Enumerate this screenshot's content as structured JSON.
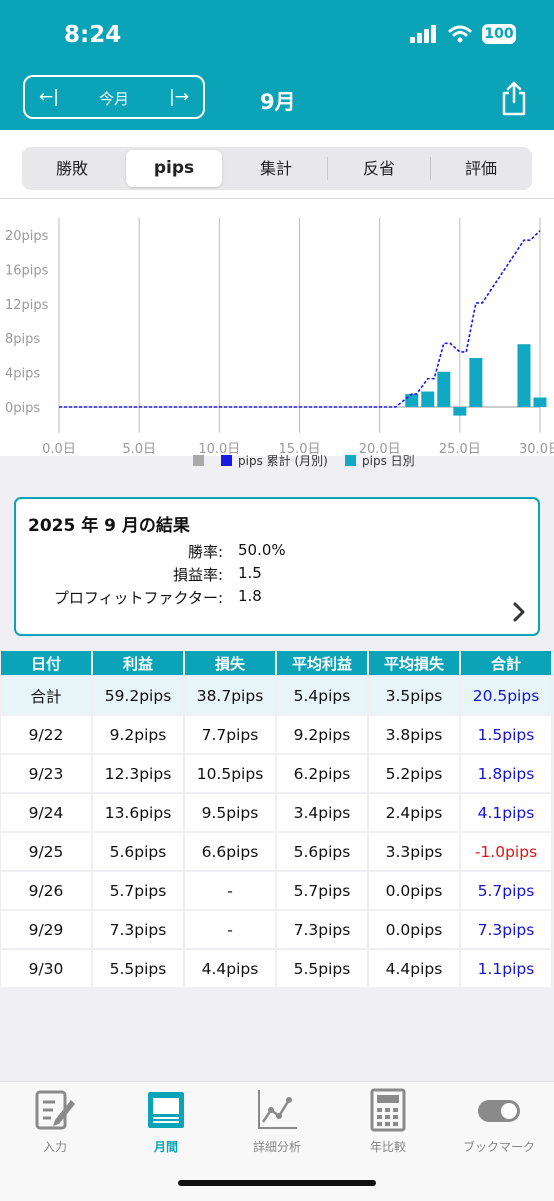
{
  "status_bar": {
    "time": "8:24",
    "battery": "100"
  },
  "header": {
    "prev_arrow": "←|",
    "today_label": "今月",
    "next_arrow": "|→",
    "month_title": "9月"
  },
  "segments": [
    "勝敗",
    "pips",
    "集計",
    "反省",
    "評価"
  ],
  "selected_segment": "pips",
  "chart_data": {
    "type": "bar+line",
    "x_tick_labels": [
      "0.0日",
      "5.0日",
      "10.0日",
      "15.0日",
      "20.0日",
      "25.0日",
      "30.0日"
    ],
    "y_tick_labels": [
      "0pips",
      "4pips",
      "8pips",
      "12pips",
      "16pips",
      "20pips"
    ],
    "xlim": [
      0,
      30
    ],
    "ylim": [
      -3,
      22
    ],
    "grid": true,
    "legend_placement": "bottom",
    "legend": [
      "",
      "pips 累計 (月別)",
      "pips 日別"
    ],
    "series": [
      {
        "name": "pips 累計 (月別)",
        "type": "line",
        "style": "dashed",
        "color": "#1a1ae6",
        "x": [
          0,
          21,
          22,
          22.3,
          23,
          23.4,
          24,
          24.4,
          25,
          25.4,
          26,
          26.4,
          29,
          29.4,
          30
        ],
        "y": [
          0,
          0,
          1.5,
          1.5,
          3.3,
          3.3,
          7.4,
          7.4,
          6.4,
          6.4,
          12.1,
          12.1,
          19.4,
          19.4,
          20.5
        ]
      },
      {
        "name": "pips 日別",
        "type": "bar",
        "color": "#10a8c2",
        "x": [
          22,
          23,
          24,
          25,
          26,
          29,
          30
        ],
        "values": [
          1.5,
          1.8,
          4.1,
          -1.0,
          5.7,
          7.3,
          1.1
        ]
      }
    ]
  },
  "result": {
    "title": "2025 年 9 月の結果",
    "win_rate_label": "勝率:",
    "win_rate": "50.0%",
    "pl_ratio_label": "損益率:",
    "pl_ratio": "1.5",
    "profit_factor_label": "プロフィットファクター:",
    "profit_factor": "1.8"
  },
  "table": {
    "headers": [
      "日付",
      "利益",
      "損失",
      "平均利益",
      "平均損失",
      "合計"
    ],
    "rows": [
      {
        "date": "合計",
        "profit": "59.2pips",
        "loss": "38.7pips",
        "avg_profit": "5.4pips",
        "avg_loss": "3.5pips",
        "total": "20.5pips",
        "sign": "pos"
      },
      {
        "date": "9/22",
        "profit": "9.2pips",
        "loss": "7.7pips",
        "avg_profit": "9.2pips",
        "avg_loss": "3.8pips",
        "total": "1.5pips",
        "sign": "pos"
      },
      {
        "date": "9/23",
        "profit": "12.3pips",
        "loss": "10.5pips",
        "avg_profit": "6.2pips",
        "avg_loss": "5.2pips",
        "total": "1.8pips",
        "sign": "pos"
      },
      {
        "date": "9/24",
        "profit": "13.6pips",
        "loss": "9.5pips",
        "avg_profit": "3.4pips",
        "avg_loss": "2.4pips",
        "total": "4.1pips",
        "sign": "pos"
      },
      {
        "date": "9/25",
        "profit": "5.6pips",
        "loss": "6.6pips",
        "avg_profit": "5.6pips",
        "avg_loss": "3.3pips",
        "total": "-1.0pips",
        "sign": "neg"
      },
      {
        "date": "9/26",
        "profit": "5.7pips",
        "loss": "-",
        "avg_profit": "5.7pips",
        "avg_loss": "0.0pips",
        "total": "5.7pips",
        "sign": "pos"
      },
      {
        "date": "9/29",
        "profit": "7.3pips",
        "loss": "-",
        "avg_profit": "7.3pips",
        "avg_loss": "0.0pips",
        "total": "7.3pips",
        "sign": "pos"
      },
      {
        "date": "9/30",
        "profit": "5.5pips",
        "loss": "4.4pips",
        "avg_profit": "5.5pips",
        "avg_loss": "4.4pips",
        "total": "1.1pips",
        "sign": "pos"
      }
    ]
  },
  "tabbar": {
    "items": [
      {
        "label": "入力",
        "icon": "edit-icon"
      },
      {
        "label": "月間",
        "icon": "calendar-icon"
      },
      {
        "label": "詳細分析",
        "icon": "line-chart-icon"
      },
      {
        "label": "年比較",
        "icon": "calculator-icon"
      },
      {
        "label": "ブックマーク",
        "icon": "toggle-icon"
      }
    ],
    "active": "月間"
  },
  "colors": {
    "accent": "#0aa3b8",
    "positive": "#1414d2",
    "negative": "#e21414"
  }
}
